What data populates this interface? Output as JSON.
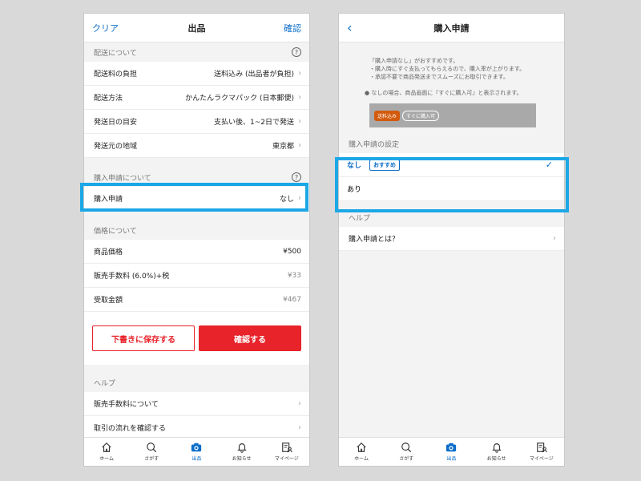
{
  "left": {
    "nav": {
      "clear": "クリア",
      "title": "出品",
      "confirm": "確認"
    },
    "shipping_section": "配送について",
    "help_mark": "?",
    "shipping_rows": [
      {
        "label": "配送料の負担",
        "value": "送料込み (出品者が負担)"
      },
      {
        "label": "配送方法",
        "value": "かんたんラクマパック (日本郵便)"
      },
      {
        "label": "発送日の目安",
        "value": "支払い後、1~2日で発送"
      },
      {
        "label": "発送元の地域",
        "value": "東京都"
      }
    ],
    "purchase_section": "購入申請について",
    "purchase_row": {
      "label": "購入申請",
      "value": "なし"
    },
    "price_section": "価格について",
    "price_rows": [
      {
        "label": "商品価格",
        "value": "¥500"
      },
      {
        "label": "販売手数料 (6.0%)+税",
        "value": "¥33"
      },
      {
        "label": "受取金額",
        "value": "¥467"
      }
    ],
    "buttons": {
      "draft": "下書きに保存する",
      "confirm": "確認する"
    },
    "help_section": "ヘルプ",
    "help_rows": [
      "販売手数料について",
      "取引の流れを確認する"
    ]
  },
  "right": {
    "nav": {
      "back": "‹",
      "title": "購入申請"
    },
    "info": [
      "「購入申請なし」がおすすめです。",
      "・購入時にすぐ支払ってもらえるので、購入率が上がります。",
      "・承認不要で商品発送までスムーズにお取引できます。"
    ],
    "note": "● なしの場合、商品画面に『すぐに購入可』と表示されます。",
    "preview": {
      "shipping_badge": "送料込み",
      "instant_badge": "すぐに購入可"
    },
    "setting_section": "購入申請の設定",
    "options": [
      {
        "label": "なし",
        "badge": "おすすめ",
        "check": "✓"
      },
      {
        "label": "あり"
      }
    ],
    "help_section": "ヘルプ",
    "help_rows": [
      "購入申請とは？"
    ]
  },
  "tabs": [
    "ホーム",
    "さがす",
    "出品",
    "お知らせ",
    "マイページ"
  ],
  "colors": {
    "accent": "#0b6dc9",
    "brand_red": "#e8232a",
    "highlight": "#1ca7e6"
  }
}
